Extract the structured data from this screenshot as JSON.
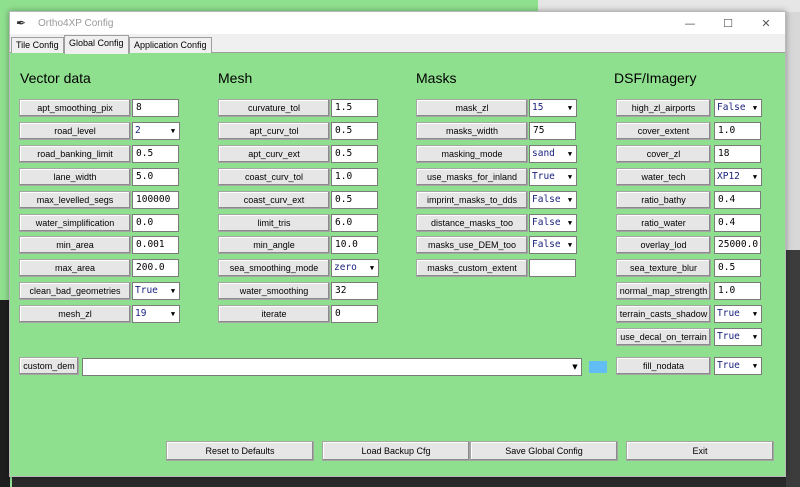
{
  "window": {
    "title": "Ortho4XP Config",
    "icon": "feather-icon"
  },
  "controls": {
    "minimize": "—",
    "maximize": "☐",
    "close": "✕"
  },
  "tabs": [
    "Tile Config",
    "Global Config",
    "Application Config"
  ],
  "active_tab": "Global Config",
  "sections": {
    "vector": {
      "heading": "Vector data",
      "fields": [
        {
          "label": "apt_smoothing_pix",
          "value": "8",
          "type": "entry"
        },
        {
          "label": "road_level",
          "value": "2",
          "type": "combo"
        },
        {
          "label": "road_banking_limit",
          "value": "0.5",
          "type": "entry"
        },
        {
          "label": "lane_width",
          "value": "5.0",
          "type": "entry"
        },
        {
          "label": "max_levelled_segs",
          "value": "100000",
          "type": "entry"
        },
        {
          "label": "water_simplification",
          "value": "0.0",
          "type": "entry"
        },
        {
          "label": "min_area",
          "value": "0.001",
          "type": "entry"
        },
        {
          "label": "max_area",
          "value": "200.0",
          "type": "entry"
        },
        {
          "label": "clean_bad_geometries",
          "value": "True",
          "type": "combo"
        },
        {
          "label": "mesh_zl",
          "value": "19",
          "type": "combo"
        }
      ]
    },
    "mesh": {
      "heading": "Mesh",
      "fields": [
        {
          "label": "curvature_tol",
          "value": "1.5",
          "type": "entry"
        },
        {
          "label": "apt_curv_tol",
          "value": "0.5",
          "type": "entry"
        },
        {
          "label": "apt_curv_ext",
          "value": "0.5",
          "type": "entry"
        },
        {
          "label": "coast_curv_tol",
          "value": "1.0",
          "type": "entry"
        },
        {
          "label": "coast_curv_ext",
          "value": "0.5",
          "type": "entry"
        },
        {
          "label": "limit_tris",
          "value": "6.0",
          "type": "entry"
        },
        {
          "label": "min_angle",
          "value": "10.0",
          "type": "entry"
        },
        {
          "label": "sea_smoothing_mode",
          "value": "zero",
          "type": "combo"
        },
        {
          "label": "water_smoothing",
          "value": "32",
          "type": "entry"
        },
        {
          "label": "iterate",
          "value": "0",
          "type": "entry"
        }
      ]
    },
    "masks": {
      "heading": "Masks",
      "fields": [
        {
          "label": "mask_zl",
          "value": "15",
          "type": "combo"
        },
        {
          "label": "masks_width",
          "value": "75",
          "type": "entry"
        },
        {
          "label": "masking_mode",
          "value": "sand",
          "type": "combo"
        },
        {
          "label": "use_masks_for_inland",
          "value": "True",
          "type": "combo"
        },
        {
          "label": "imprint_masks_to_dds",
          "value": "False",
          "type": "combo"
        },
        {
          "label": "distance_masks_too",
          "value": "False",
          "type": "combo"
        },
        {
          "label": "masks_use_DEM_too",
          "value": "False",
          "type": "combo"
        },
        {
          "label": "masks_custom_extent",
          "value": "",
          "type": "entry"
        }
      ]
    },
    "dsf": {
      "heading": "DSF/Imagery",
      "fields": [
        {
          "label": "high_zl_airports",
          "value": "False",
          "type": "combo"
        },
        {
          "label": "cover_extent",
          "value": "1.0",
          "type": "entry"
        },
        {
          "label": "cover_zl",
          "value": "18",
          "type": "entry"
        },
        {
          "label": "water_tech",
          "value": "XP12",
          "type": "combo"
        },
        {
          "label": "ratio_bathy",
          "value": "0.4",
          "type": "entry"
        },
        {
          "label": "ratio_water",
          "value": "0.4",
          "type": "entry"
        },
        {
          "label": "overlay_lod",
          "value": "25000.0",
          "type": "entry"
        },
        {
          "label": "sea_texture_blur",
          "value": "0.5",
          "type": "entry"
        },
        {
          "label": "normal_map_strength",
          "value": "1.0",
          "type": "entry"
        },
        {
          "label": "terrain_casts_shadow",
          "value": "True",
          "type": "combo"
        },
        {
          "label": "use_decal_on_terrain",
          "value": "True",
          "type": "combo"
        }
      ]
    }
  },
  "custom_dem": {
    "label": "custom_dem",
    "value": ""
  },
  "fill_nodata": {
    "label": "fill_nodata",
    "value": "True"
  },
  "bottom_buttons": [
    "Reset to Defaults",
    "Load Backup Cfg",
    "Save Global Config",
    "Exit"
  ],
  "colors": {
    "background": "#8fe08e",
    "combo_text": "#1a237e",
    "swatch": "#62bdf5"
  }
}
